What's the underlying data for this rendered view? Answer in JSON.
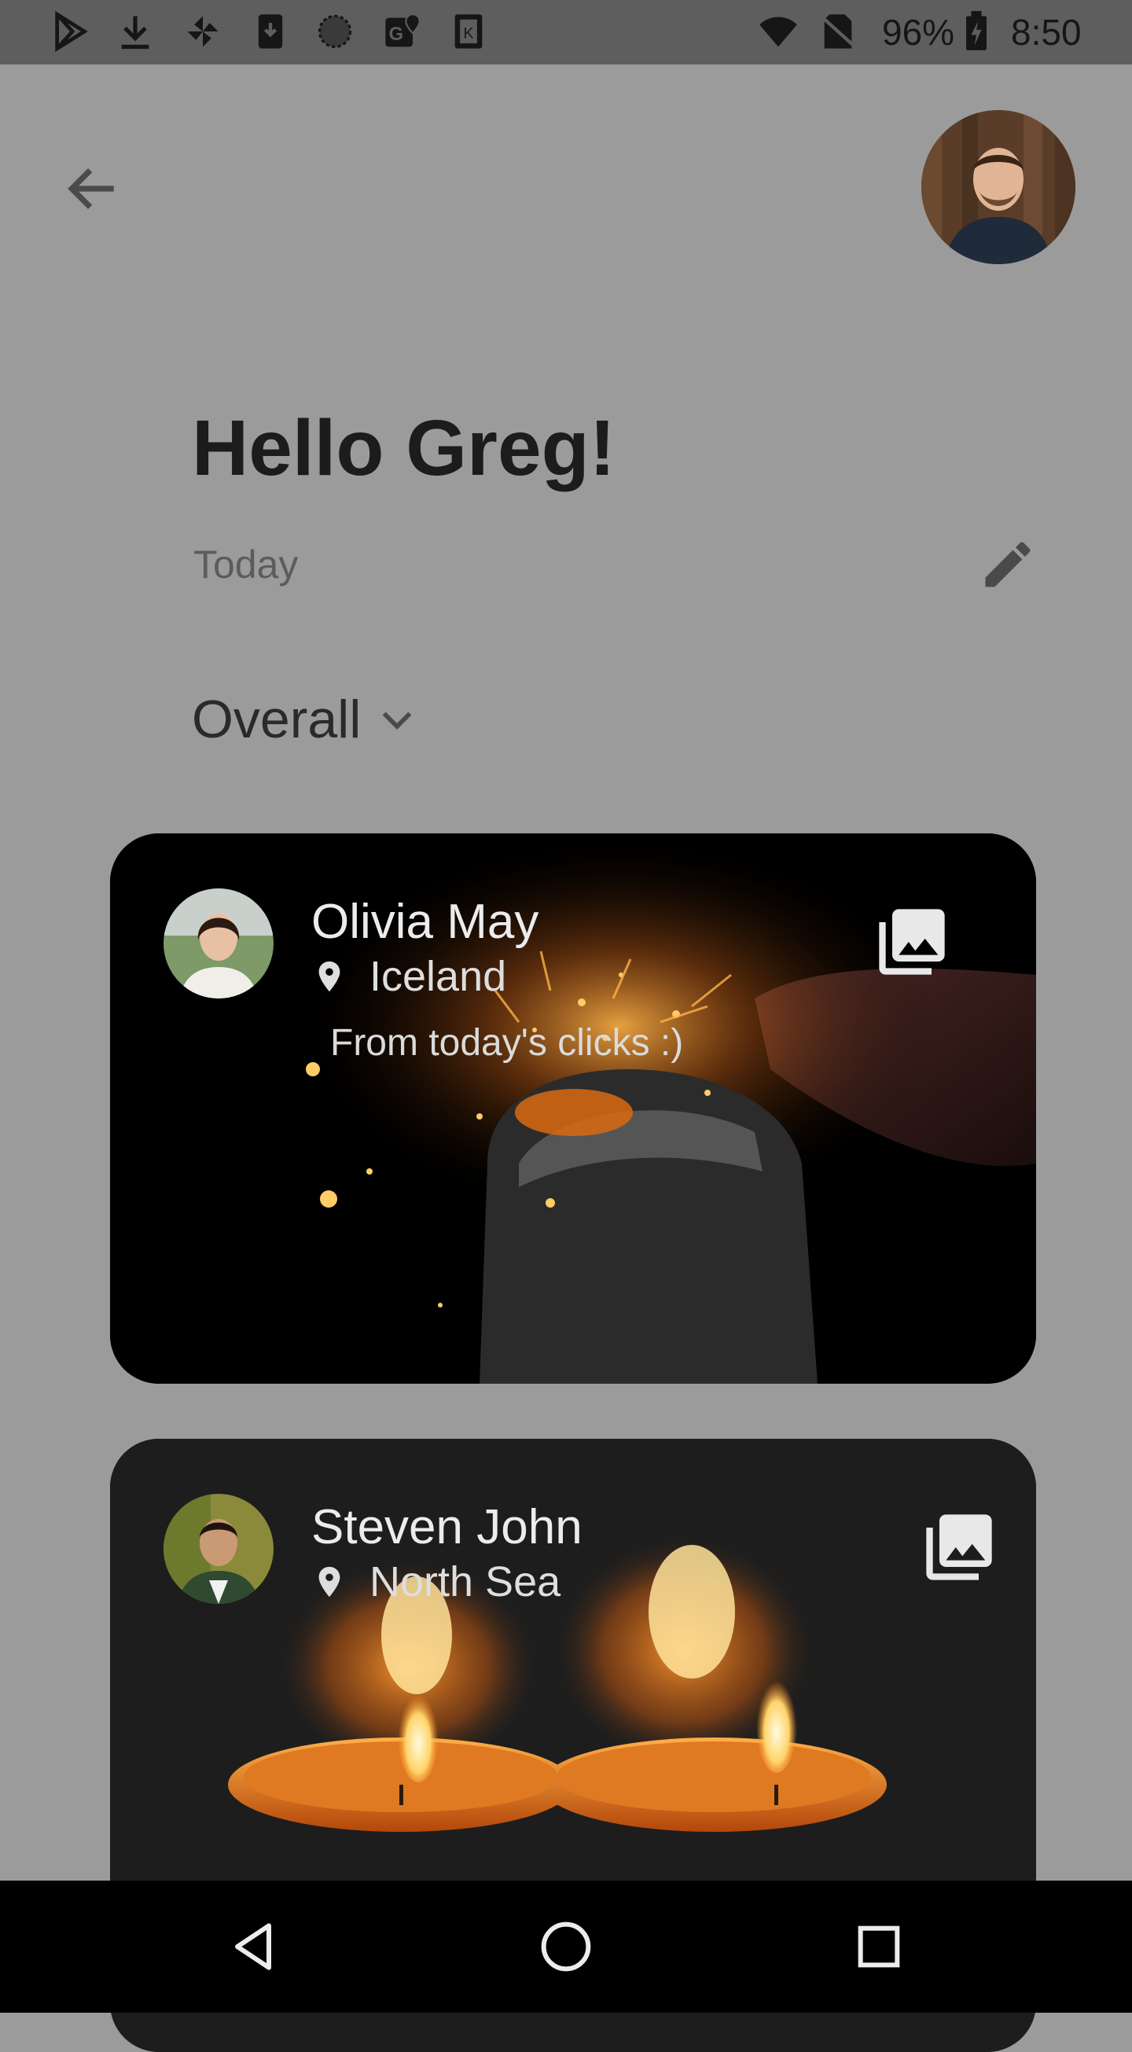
{
  "status_bar": {
    "battery": "96%",
    "time": "8:50",
    "notification_icons": [
      "play-store-icon",
      "download-icon",
      "pinwheel-icon",
      "download-phone-icon",
      "circle-icon",
      "maps-icon",
      "keep-icon"
    ]
  },
  "header": {
    "greeting": "Hello Greg!",
    "date_label": "Today",
    "filter_label": "Overall"
  },
  "posts": [
    {
      "name": "Olivia May",
      "location": "Iceland",
      "caption": "From today's clicks :)",
      "photo": "lighter-sparks-photo"
    },
    {
      "name": "Steven John",
      "location": "North Sea",
      "photo": "tealight-candles-photo"
    }
  ],
  "colors": {
    "background": "#9b9b9b",
    "status_bar": "#5e5e5e",
    "card_dark": "#1d1d1d",
    "text_light": "#ececec",
    "flame": "#ff9a2e"
  }
}
